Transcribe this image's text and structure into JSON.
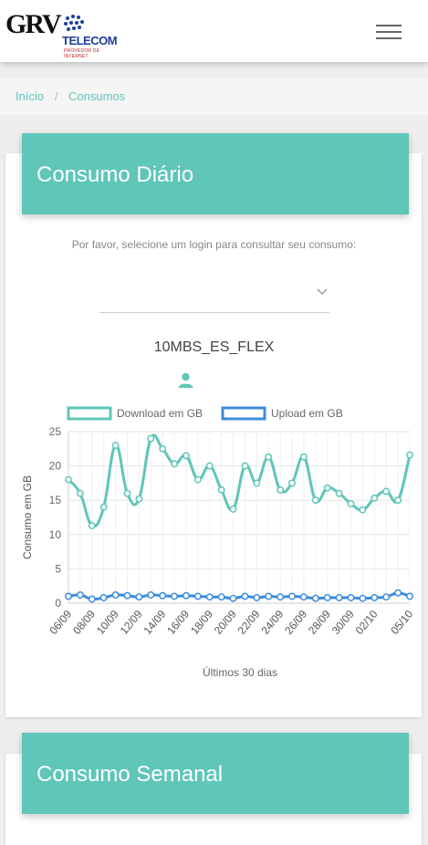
{
  "brand": {
    "logo_main": "GRV",
    "logo_telecom": "TELECOM",
    "logo_sub": "PROVEDOR DE INTERNET"
  },
  "breadcrumb": [
    {
      "label": "Início"
    },
    {
      "label": "Consumos"
    }
  ],
  "daily": {
    "title": "Consumo Diário",
    "prompt": "Por favor, selecione um login para consultar seu consumo:",
    "select_value": "",
    "login_name": "10MBS_ES_FLEX"
  },
  "weekly": {
    "title": "Consumo Semanal"
  },
  "colors": {
    "accent": "#5fc6b8",
    "download": "#5fc6b8",
    "upload": "#3d8cdb"
  },
  "icons": {
    "menu": "hamburger-icon",
    "select": "chevron-down-icon",
    "user": "user-icon"
  },
  "chart_data": {
    "type": "line",
    "xlabel": "Últimos 30 dias",
    "ylabel": "Consumo em GB",
    "ylim": [
      0,
      25
    ],
    "yticks": [
      0,
      5,
      10,
      15,
      20,
      25
    ],
    "grid": true,
    "legend_position": "top",
    "x": [
      "06/09",
      "07/09",
      "08/09",
      "09/09",
      "10/09",
      "11/09",
      "12/09",
      "13/09",
      "14/09",
      "15/09",
      "16/09",
      "17/09",
      "18/09",
      "19/09",
      "20/09",
      "21/09",
      "22/09",
      "23/09",
      "24/09",
      "25/09",
      "26/09",
      "27/09",
      "28/09",
      "29/09",
      "30/09",
      "01/10",
      "02/10",
      "03/10",
      "04/10",
      "05/10"
    ],
    "tick_labels": [
      "06/09",
      "08/09",
      "10/09",
      "12/09",
      "14/09",
      "16/09",
      "18/09",
      "20/09",
      "22/09",
      "24/09",
      "26/09",
      "28/09",
      "30/09",
      "02/10",
      "05/10"
    ],
    "series": [
      {
        "name": "Download em GB",
        "color": "#5fc6b8",
        "values": [
          18,
          16,
          11.3,
          14,
          23,
          16,
          15.2,
          24,
          22.5,
          20.3,
          21.5,
          18,
          20,
          16.5,
          13.7,
          20,
          17.5,
          21.3,
          16.5,
          17.5,
          21.3,
          15,
          16.8,
          16,
          14.5,
          13.6,
          15.3,
          16.3,
          15,
          21.6
        ]
      },
      {
        "name": "Upload em GB",
        "color": "#3d8cdb",
        "values": [
          1,
          1.2,
          0.6,
          0.8,
          1.2,
          1.1,
          0.9,
          1.2,
          1.1,
          1,
          1.1,
          1,
          0.9,
          0.9,
          0.7,
          1,
          0.8,
          1,
          0.9,
          1,
          0.9,
          0.7,
          0.8,
          0.8,
          0.8,
          0.7,
          0.8,
          0.9,
          1.5,
          1
        ]
      }
    ]
  }
}
